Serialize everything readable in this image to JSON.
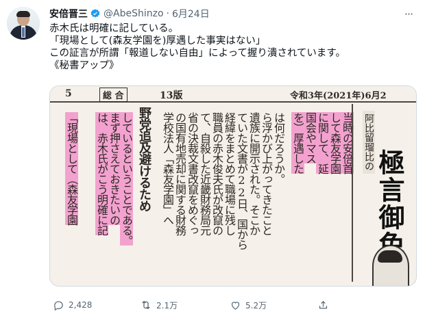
{
  "tweet": {
    "author_name": "安倍晋三",
    "handle": "@AbeShinzo",
    "separator": "·",
    "date": "6月24日",
    "more_label": "···",
    "lines": [
      "赤木氏は明確に記している。",
      "「現場として(森友学園を)厚遇した事実はない」",
      "この証言が所謂「報道しない自由」によって握り潰されています。",
      "《秘書アップ》"
    ]
  },
  "newspaper": {
    "page_number": "5",
    "section": "総 合",
    "edition": "13版",
    "date": "令和3年(2021年)6月2",
    "columns": [
      "「現場として（森友学園",
      "は、赤木氏がこう明確に記",
      "まず押さえておきたいの",
      "しているということである。",
      "野党追及避けるため",
      "学校法人「森友学園」へ",
      "の国有地売却に関する財務",
      "省の決裁文書改竄をめぐっ",
      "て、自殺した近畿財務局元",
      "職員の赤木俊夫氏が改竄の",
      "経緯をまとめて職場に残し",
      "ていた文書が22日、国から",
      "遺族に開示された。そこか",
      "ら浮かび上がってきたこと",
      "は何だろうか。",
      "を）厚遇した",
      "国会やマス",
      "に関して、延",
      "して森友学園",
      "当時の安倍首"
    ],
    "feature_small": "阿比留瑠比の",
    "feature_big": "極言御免"
  },
  "actions": {
    "reply_count": "2,428",
    "retweet_count": "2.1万",
    "like_count": "5.2万"
  },
  "colors": {
    "highlight": "#f3a2cf",
    "verified_blue": "#1d9bf0",
    "muted": "#536471"
  }
}
